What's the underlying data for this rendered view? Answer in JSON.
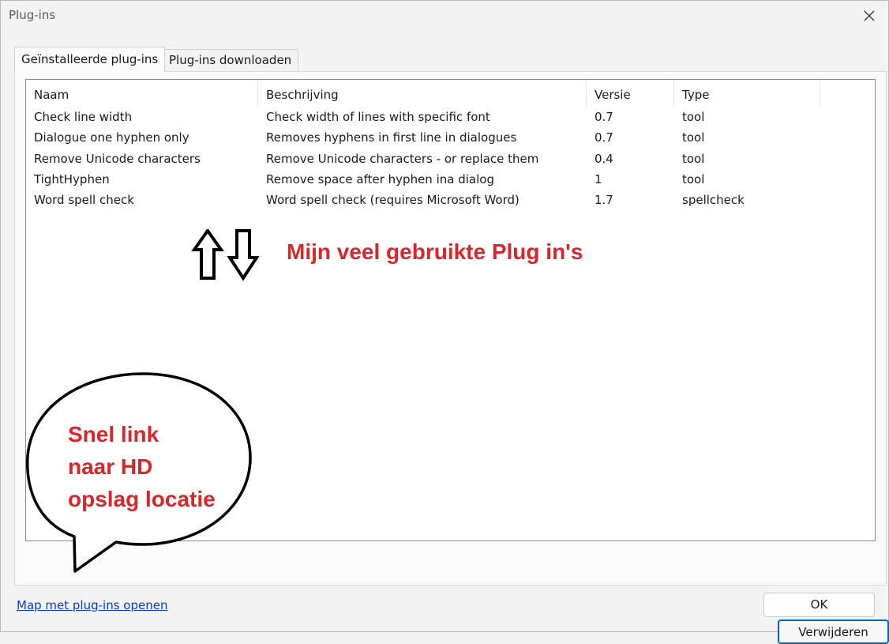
{
  "window": {
    "title": "Plug-ins"
  },
  "tabs": [
    {
      "label": "Geïnstalleerde plug-ins",
      "active": true
    },
    {
      "label": "Plug-ins downloaden",
      "active": false
    }
  ],
  "table": {
    "columns": [
      "Naam",
      "Beschrijving",
      "Versie",
      "Type"
    ],
    "rows": [
      [
        "Check line width",
        "Check width of lines with specific font",
        "0.7",
        "tool"
      ],
      [
        "Dialogue one hyphen only",
        "Removes hyphens in first line in dialogues",
        "0.7",
        "tool"
      ],
      [
        "Remove Unicode characters",
        "Remove Unicode characters - or replace them",
        "0.4",
        "tool"
      ],
      [
        "TightHyphen",
        "Remove space after hyphen ina dialog",
        "1",
        "tool"
      ],
      [
        "Word spell check",
        "Word spell check (requires Microsoft Word)",
        "1.7",
        "spellcheck"
      ]
    ]
  },
  "annotations": {
    "arrows_label": "Mijn veel gebruikte Plug in's",
    "bubble_lines": [
      "Snel link",
      "naar HD",
      "opslag locatie"
    ]
  },
  "buttons": {
    "remove": "Verwijderen",
    "ok": "OK"
  },
  "footer": {
    "link": "Map met plug-ins openen"
  },
  "colors": {
    "annotation": "#d9262b",
    "link": "#0b39d8",
    "focus_border": "#0067c0"
  },
  "icons": {
    "close": "close-icon",
    "up_arrow": "arrow-up-icon",
    "down_arrow": "arrow-down-icon"
  }
}
